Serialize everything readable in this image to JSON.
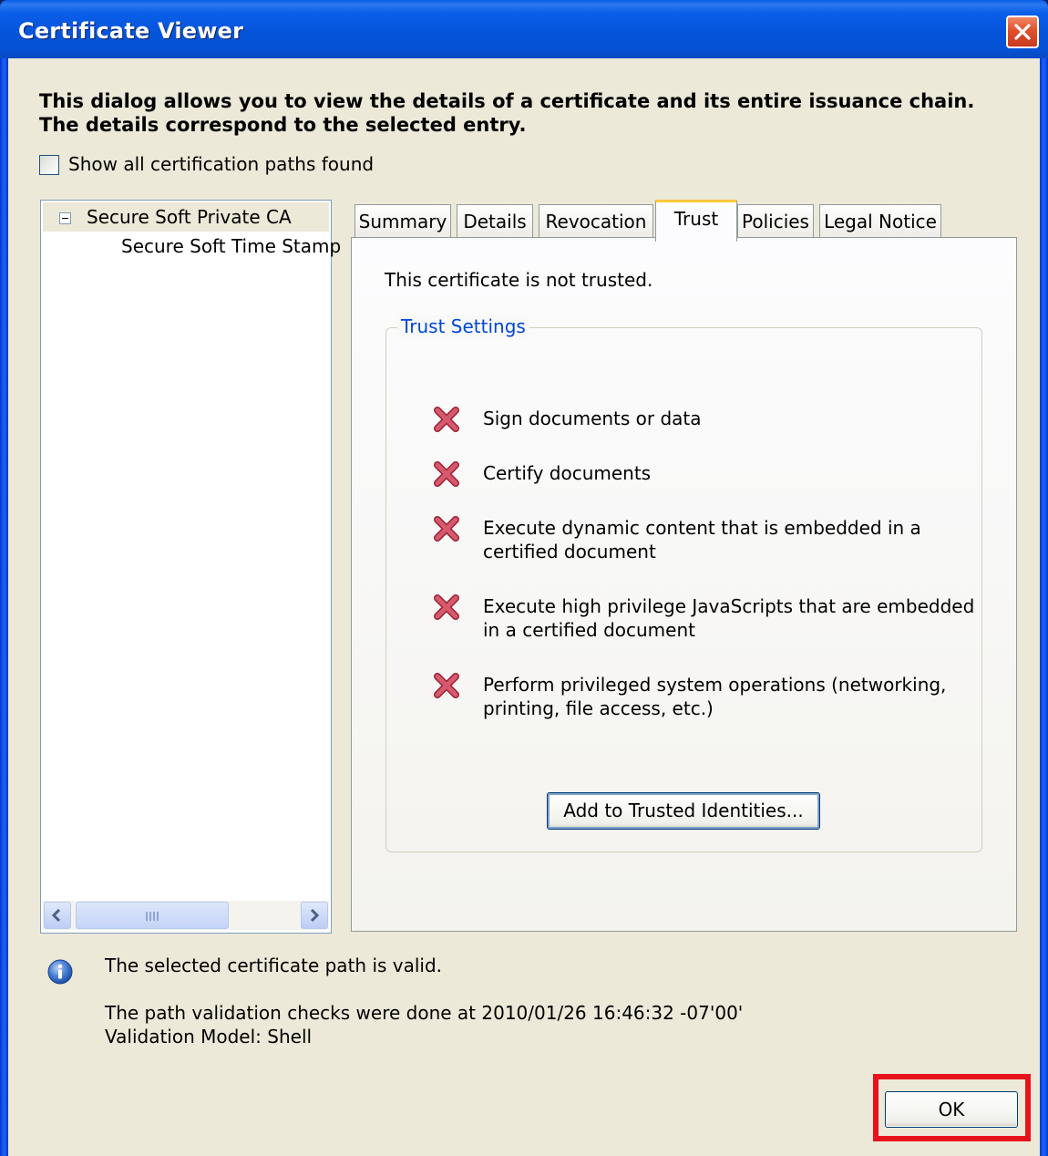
{
  "window": {
    "title": "Certificate Viewer"
  },
  "intro_text": "This dialog allows you to view the details of a certificate and its entire issuance chain. The details correspond to the selected entry.",
  "show_all_paths": {
    "label": "Show all certification paths found",
    "checked": false
  },
  "tree": {
    "items": [
      {
        "label": "Secure Soft Private CA",
        "expanded": true,
        "selected": true
      },
      {
        "label": "Secure Soft Time Stamp"
      }
    ]
  },
  "tabs": [
    {
      "label": "Summary"
    },
    {
      "label": "Details"
    },
    {
      "label": "Revocation"
    },
    {
      "label": "Trust",
      "active": true
    },
    {
      "label": "Policies"
    },
    {
      "label": "Legal Notice"
    }
  ],
  "trust": {
    "status": "This certificate is not trusted.",
    "group_title": "Trust Settings",
    "permissions": [
      {
        "icon": "red-x-icon",
        "line1": "Sign documents or data",
        "line2": ""
      },
      {
        "icon": "red-x-icon",
        "line1": "Certify documents",
        "line2": ""
      },
      {
        "icon": "red-x-icon",
        "line1": "Execute dynamic content that is embedded in a",
        "line2": "certified document"
      },
      {
        "icon": "red-x-icon",
        "line1": "Execute high privilege JavaScripts that are embedded",
        "line2": "in a certified document"
      },
      {
        "icon": "red-x-icon",
        "line1": "Perform privileged system operations (networking,",
        "line2": "printing, file access, etc.)"
      }
    ],
    "add_button": "Add to Trusted Identities..."
  },
  "status": {
    "path_valid": "The selected certificate path is valid.",
    "checked_at": "The path validation checks were done at 2010/01/26 16:46:32 -07'00'",
    "model": "Validation Model: Shell"
  },
  "ok_button": "OK",
  "colors": {
    "accent_blue": "#0a5ee8",
    "deny_red": "#c2384a",
    "highlight_red": "#e8121c"
  }
}
